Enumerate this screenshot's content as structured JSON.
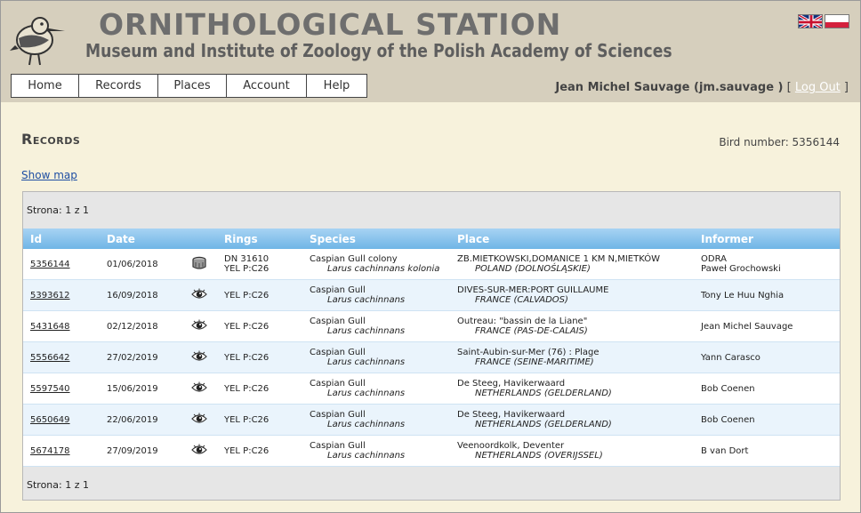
{
  "header": {
    "title": "ORNITHOLOGICAL STATION",
    "subtitle": "Museum and Institute of Zoology of the Polish Academy of Sciences",
    "flags": [
      "uk-flag-icon",
      "poland-flag-icon"
    ]
  },
  "nav": {
    "items": [
      {
        "label": "Home"
      },
      {
        "label": "Records"
      },
      {
        "label": "Places"
      },
      {
        "label": "Account"
      },
      {
        "label": "Help"
      }
    ]
  },
  "user": {
    "name": "Jean Michel Sauvage (jm.sauvage )",
    "open_bracket": " [ ",
    "logout_label": "Log Out",
    "close_bracket": " ]"
  },
  "page": {
    "title": "Records",
    "bird_number": "Bird number: 5356144",
    "show_map": "Show map",
    "pager_top": "Strona: 1 z 1",
    "pager_bottom": "Strona: 1 z 1"
  },
  "table": {
    "columns": [
      "Id",
      "Date",
      "",
      "Rings",
      "Species",
      "Place",
      "Informer"
    ],
    "rows": [
      {
        "id": "5356144",
        "date": "01/06/2018",
        "icon": "ring-icon",
        "rings": [
          "DN 31610",
          "YEL P:C26"
        ],
        "species": "Caspian Gull colony",
        "latin": "Larus cachinnans kolonia",
        "place": "ZB.MIETKOWSKI,DOMANICE 1 KM N,MIETKÓW",
        "country": "POLAND (DOLNOŚLĄSKIE)",
        "informer": [
          "ODRA",
          "Paweł Grochowski"
        ]
      },
      {
        "id": "5393612",
        "date": "16/09/2018",
        "icon": "eye-icon",
        "rings": [
          "YEL P:C26"
        ],
        "species": "Caspian Gull",
        "latin": "Larus cachinnans",
        "place": "DIVES-SUR-MER:PORT GUILLAUME",
        "country": "FRANCE (CALVADOS)",
        "informer": [
          "Tony Le Huu Nghia"
        ]
      },
      {
        "id": "5431648",
        "date": "02/12/2018",
        "icon": "eye-icon",
        "rings": [
          "YEL P:C26"
        ],
        "species": "Caspian Gull",
        "latin": "Larus cachinnans",
        "place": "Outreau: \"bassin de la Liane\"",
        "country": "FRANCE (PAS-DE-CALAIS)",
        "informer": [
          "Jean Michel Sauvage"
        ]
      },
      {
        "id": "5556642",
        "date": "27/02/2019",
        "icon": "eye-icon",
        "rings": [
          "YEL P:C26"
        ],
        "species": "Caspian Gull",
        "latin": "Larus cachinnans",
        "place": "Saint-Aubin-sur-Mer (76) : Plage",
        "country": "FRANCE (SEINE-MARITIME)",
        "informer": [
          "Yann Carasco"
        ]
      },
      {
        "id": "5597540",
        "date": "15/06/2019",
        "icon": "eye-icon",
        "rings": [
          "YEL P:C26"
        ],
        "species": "Caspian Gull",
        "latin": "Larus cachinnans",
        "place": "De Steeg, Havikerwaard",
        "country": "NETHERLANDS (GELDERLAND)",
        "informer": [
          "Bob Coenen"
        ]
      },
      {
        "id": "5650649",
        "date": "22/06/2019",
        "icon": "eye-icon",
        "rings": [
          "YEL P:C26"
        ],
        "species": "Caspian Gull",
        "latin": "Larus cachinnans",
        "place": "De Steeg, Havikerwaard",
        "country": "NETHERLANDS (GELDERLAND)",
        "informer": [
          "Bob Coenen"
        ]
      },
      {
        "id": "5674178",
        "date": "27/09/2019",
        "icon": "eye-icon",
        "rings": [
          "YEL P:C26"
        ],
        "species": "Caspian Gull",
        "latin": "Larus cachinnans",
        "place": "Veenoordkolk, Deventer",
        "country": "NETHERLANDS (OVERIJSSEL)",
        "informer": [
          "B van Dort"
        ]
      }
    ]
  }
}
